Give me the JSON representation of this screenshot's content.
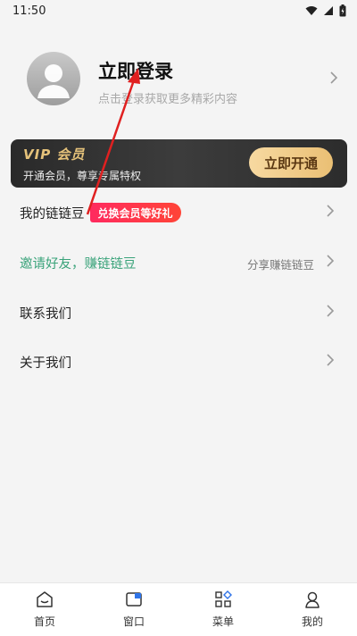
{
  "status_bar": {
    "time": "11:50"
  },
  "profile": {
    "title": "立即登录",
    "subtitle": "点击登录获取更多精彩内容"
  },
  "vip": {
    "logo": "VIP 会员",
    "description": "开通会员，尊享专属特权",
    "button": "立即开通"
  },
  "menu": {
    "beans": {
      "label": "我的链链豆",
      "badge": "兑换会员等好礼"
    },
    "invite": {
      "label": "邀请好友，赚链链豆",
      "right": "分享赚链链豆"
    },
    "contact": {
      "label": "联系我们"
    },
    "about": {
      "label": "关于我们"
    }
  },
  "tabs": [
    {
      "label": "首页",
      "icon": "home-icon"
    },
    {
      "label": "窗口",
      "icon": "window-icon"
    },
    {
      "label": "菜单",
      "icon": "menu-grid-icon"
    },
    {
      "label": "我的",
      "icon": "profile-icon"
    }
  ],
  "colors": {
    "vip_gold": "#e5c27a",
    "badge_red": "#ff2a5f",
    "invite_green": "#3aa37a",
    "annotation_red": "#e02020"
  }
}
